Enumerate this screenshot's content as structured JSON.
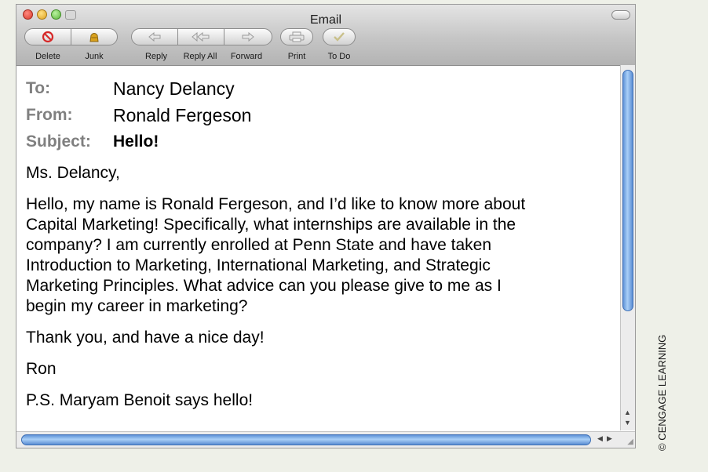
{
  "window": {
    "title": "Email"
  },
  "toolbar": {
    "delete": "Delete",
    "junk": "Junk",
    "reply": "Reply",
    "reply_all": "Reply All",
    "forward": "Forward",
    "print": "Print",
    "todo": "To Do"
  },
  "header": {
    "to_label": "To:",
    "to_value": "Nancy Delancy",
    "from_label": "From:",
    "from_value": "Ronald Fergeson",
    "subject_label": "Subject:",
    "subject_value": "Hello!"
  },
  "body": {
    "greeting": "Ms. Delancy,",
    "paragraph_lines": [
      "Hello, my name is Ronald Fergeson, and I’d like to know more about",
      "Capital Marketing! Specifically, what internships are available in the",
      "company? I am currently enrolled at Penn State and have taken",
      "Introduction to Marketing, International Marketing, and Strategic",
      "Marketing Principles. What advice can you please give to me as I",
      "begin my career in marketing?"
    ],
    "closing": "Thank you, and have a nice day!",
    "signature": "Ron",
    "postscript": "P.S. Maryam Benoit says hello!"
  },
  "credit": "© CENGAGE LEARNING",
  "colors": {
    "label_gray": "#808080",
    "scroll_blue": "#5f93d8"
  }
}
